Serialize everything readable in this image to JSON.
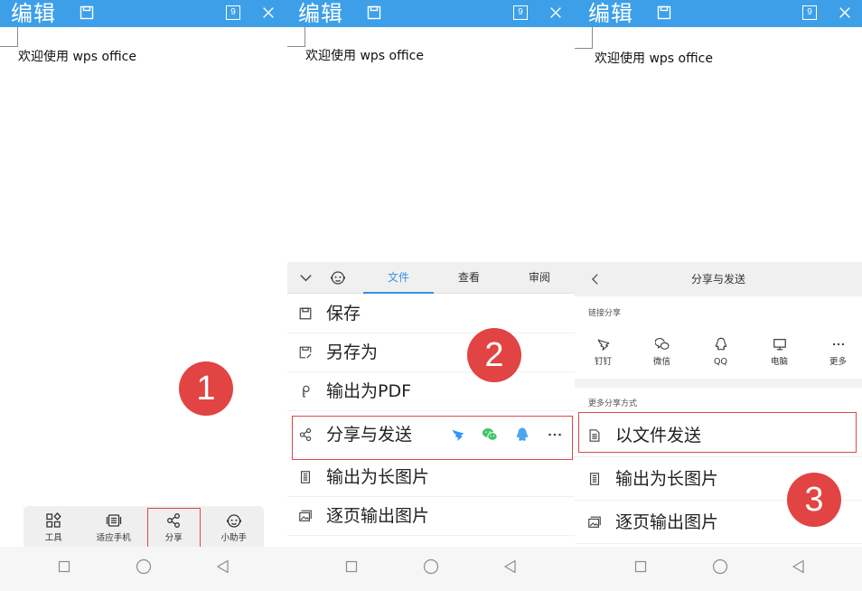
{
  "screens": [
    {
      "step_badge": "1",
      "topbar": {
        "title": "编辑",
        "save_icon": "save-icon",
        "tab_count": "9",
        "close_icon": "close-icon"
      },
      "document": {
        "text": "欢迎使用 wps office"
      },
      "bottom_toolbar": [
        {
          "label": "工具",
          "icon": "grid-icon"
        },
        {
          "label": "适应手机",
          "icon": "fit-phone-icon"
        },
        {
          "label": "分享",
          "icon": "share-icon",
          "highlighted": true
        },
        {
          "label": "小助手",
          "icon": "assistant-icon"
        }
      ],
      "nav": [
        "recents-square-icon",
        "home-circle-icon",
        "back-triangle-icon"
      ]
    },
    {
      "step_badge": "2",
      "topbar": {
        "title": "编辑",
        "save_icon": "save-icon",
        "tab_count": "9",
        "close_icon": "close-icon"
      },
      "document": {
        "text": "欢迎使用 wps office"
      },
      "menu_header_icons": [
        "chevron-down-icon",
        "assistant-icon"
      ],
      "menu_tabs": [
        {
          "label": "文件",
          "active": true
        },
        {
          "label": "查看",
          "active": false
        },
        {
          "label": "审阅",
          "active": false
        }
      ],
      "menu_items": [
        {
          "label": "保存",
          "icon": "save-icon"
        },
        {
          "label": "另存为",
          "icon": "save-as-icon"
        },
        {
          "label": "输出为PDF",
          "icon": "pdf-export-icon"
        },
        {
          "label": "分享与发送",
          "icon": "share-icon",
          "highlighted": true,
          "quick_share_icons": [
            "dingtalk-icon",
            "wechat-icon",
            "qq-icon",
            "more-icon"
          ]
        },
        {
          "label": "输出为长图片",
          "icon": "long-image-icon"
        },
        {
          "label": "逐页输出图片",
          "icon": "page-images-icon"
        }
      ],
      "nav": [
        "recents-square-icon",
        "home-circle-icon",
        "back-triangle-icon"
      ]
    },
    {
      "step_badge": "3",
      "topbar": {
        "title": "编辑",
        "save_icon": "save-icon",
        "tab_count": "9",
        "close_icon": "close-icon"
      },
      "document": {
        "text": "欢迎使用 wps office"
      },
      "share_panel": {
        "back_icon": "chevron-left-icon",
        "title": "分享与发送",
        "link_share_label": "链接分享",
        "link_share_targets": [
          {
            "label": "钉钉",
            "icon": "dingtalk-icon"
          },
          {
            "label": "微信",
            "icon": "wechat-icon"
          },
          {
            "label": "QQ",
            "icon": "qq-icon"
          },
          {
            "label": "电脑",
            "icon": "computer-icon"
          },
          {
            "label": "更多",
            "icon": "more-icon"
          }
        ],
        "more_methods_label": "更多分享方式",
        "methods": [
          {
            "label": "以文件发送",
            "icon": "file-icon",
            "highlighted": true
          },
          {
            "label": "输出为长图片",
            "icon": "long-image-icon"
          },
          {
            "label": "逐页输出图片",
            "icon": "page-images-icon"
          }
        ]
      },
      "nav": [
        "recents-square-icon",
        "home-circle-icon",
        "back-triangle-icon"
      ]
    }
  ],
  "colors": {
    "topbar": "#3d9fe8",
    "accent": "#3b8fe3",
    "highlight_border": "#e04646",
    "step_badge": "#e24343",
    "dingtalk": "#3296fa",
    "wechat": "#3cc566",
    "qq": "#4aa6ef"
  }
}
